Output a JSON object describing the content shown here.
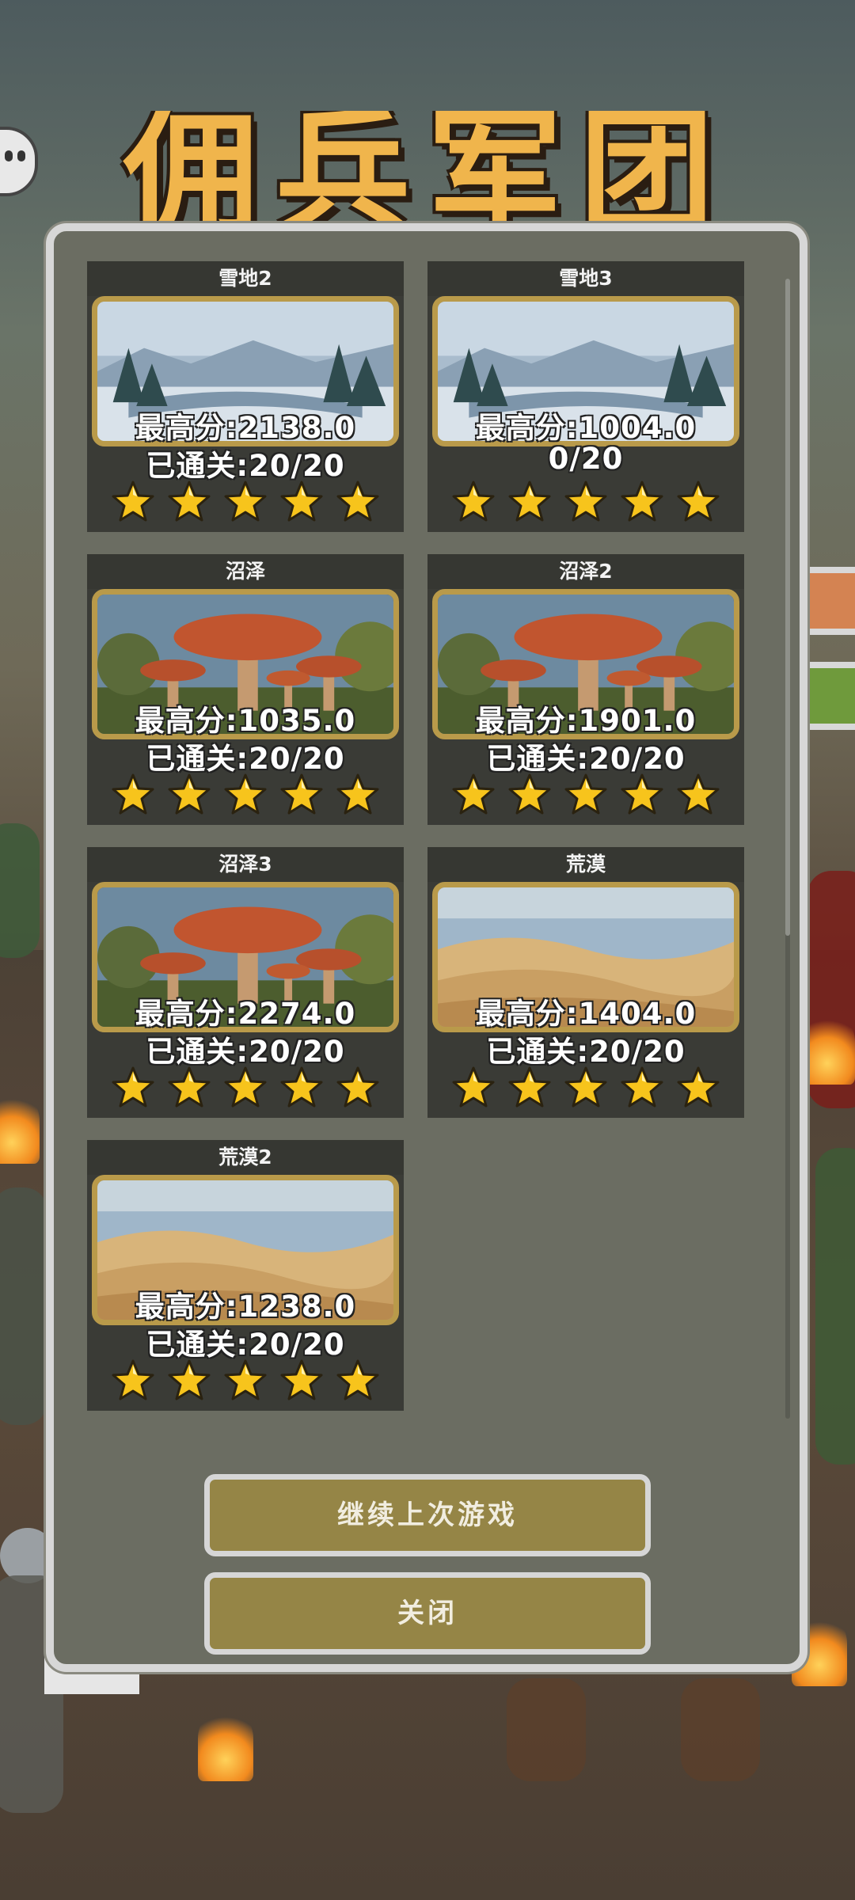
{
  "background": {
    "game_title": "佣兵军团",
    "colors": {
      "sky_top": "#4d5b5e",
      "ground": "#4c4136",
      "title": "#f0b54c"
    }
  },
  "modal": {
    "levels": [
      {
        "title": "雪地2",
        "best_score": "最高分:2138.0",
        "cleared": "已通关:20/20",
        "stars": 5,
        "scene": "snow"
      },
      {
        "title": "雪地3",
        "best_score": "最高分:1004.0",
        "cleared": "0/20",
        "stars": 5,
        "scene": "snow"
      },
      {
        "title": "沼泽",
        "best_score": "最高分:1035.0",
        "cleared": "已通关:20/20",
        "stars": 5,
        "scene": "swamp"
      },
      {
        "title": "沼泽2",
        "best_score": "最高分:1901.0",
        "cleared": "已通关:20/20",
        "stars": 5,
        "scene": "swamp"
      },
      {
        "title": "沼泽3",
        "best_score": "最高分:2274.0",
        "cleared": "已通关:20/20",
        "stars": 5,
        "scene": "swamp"
      },
      {
        "title": "荒漠",
        "best_score": "最高分:1404.0",
        "cleared": "已通关:20/20",
        "stars": 5,
        "scene": "desert"
      },
      {
        "title": "荒漠2",
        "best_score": "最高分:1238.0",
        "cleared": "已通关:20/20",
        "stars": 5,
        "scene": "desert"
      }
    ],
    "continue_label": "继续上次游戏",
    "close_label": "关闭",
    "colors": {
      "panel": "#6b6d62",
      "card": "#3a3b36",
      "button": "#958546",
      "frame": "#b99a4a",
      "star": "#f7c41c"
    }
  }
}
